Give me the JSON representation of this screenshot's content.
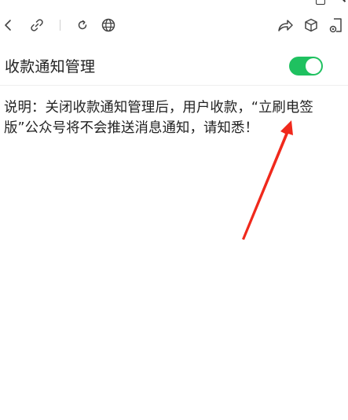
{
  "toolbar": {
    "icons": [
      "back-icon",
      "link-icon",
      "refresh-icon",
      "globe-icon",
      "share-icon",
      "cube-icon",
      "window-icon"
    ]
  },
  "setting": {
    "label": "收款通知管理",
    "enabled": true,
    "toggle_color": "#1fc160"
  },
  "description": {
    "text": "说明：关闭收款通知管理后，用户收款，“立刷电签版”公众号将不会推送消息通知，请知悉！"
  },
  "annotation": {
    "color": "#f0291c"
  }
}
